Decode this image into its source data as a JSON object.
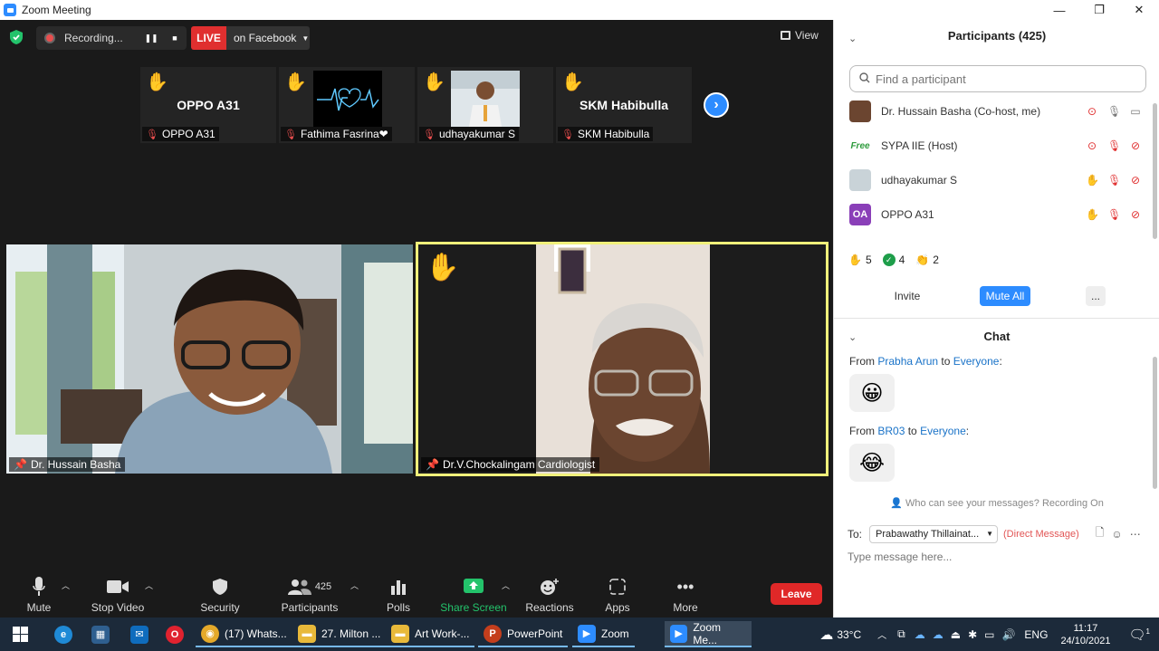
{
  "window": {
    "title": "Zoom Meeting",
    "minimize": "—",
    "maximize": "❐",
    "close": "✕"
  },
  "topbar": {
    "recording_label": "Recording...",
    "live_label": "LIVE",
    "live_destination": "on Facebook",
    "view_label": "View"
  },
  "thumbnails": [
    {
      "big_name": "OPPO A31",
      "label": "OPPO A31"
    },
    {
      "big_name": "",
      "label": "Fathima Fasrina❤"
    },
    {
      "big_name": "",
      "label": "udhayakumar S"
    },
    {
      "big_name": "SKM Habibulla",
      "label": "SKM Habibulla"
    }
  ],
  "main_tiles": [
    {
      "name": "Dr. Hussain Basha"
    },
    {
      "name": "Dr.V.Chockalingam Cardiologist"
    }
  ],
  "toolbar": {
    "mute": "Mute",
    "stop_video": "Stop Video",
    "security": "Security",
    "participants": "Participants",
    "participant_count": "425",
    "polls": "Polls",
    "share_screen": "Share Screen",
    "reactions": "Reactions",
    "apps": "Apps",
    "more": "More",
    "leave": "Leave"
  },
  "participants_panel": {
    "title": "Participants (425)",
    "search_placeholder": "Find a participant",
    "participants": [
      {
        "name": "Dr. Hussain Basha (Co-host, me)",
        "avatar": ""
      },
      {
        "name": "SYPA IIE (Host)",
        "avatar": "Free"
      },
      {
        "name": "udhayakumar S",
        "avatar": ""
      },
      {
        "name": "OPPO A31",
        "avatar": "OA"
      }
    ],
    "reaction_counts": {
      "raised_hands": "5",
      "yes": "4",
      "clap": "2"
    },
    "invite": "Invite",
    "mute_all": "Mute All",
    "more": "..."
  },
  "chat": {
    "title": "Chat",
    "messages": [
      {
        "from_prefix": "From ",
        "sender": "Prabha Arun",
        "to_word": " to ",
        "recipient": "Everyone",
        "emoji": "😀"
      },
      {
        "from_prefix": "From ",
        "sender": "BR03",
        "to_word": " to ",
        "recipient": "Everyone",
        "emoji": "😂"
      }
    ],
    "colon": ":",
    "visibility_note": "Who can see your messages? Recording On",
    "to_label": "To:",
    "to_value": "Prabawathy Thillainat...",
    "dm_note": "(Direct Message)",
    "input_placeholder": "Type message here..."
  },
  "taskbar": {
    "items": [
      {
        "label": "(17) Whats..."
      },
      {
        "label": "27. Milton ..."
      },
      {
        "label": "Art Work-..."
      },
      {
        "label": "PowerPoint"
      },
      {
        "label": "Zoom"
      },
      {
        "label": "Zoom Me..."
      }
    ],
    "temperature": "33°C",
    "language": "ENG",
    "time": "11:17",
    "date": "24/10/2021",
    "notification_count": "1"
  },
  "colors": {
    "accent": "#2d8cff",
    "live_red": "#e02f2f",
    "active_border": "#f0f07a",
    "taskbar": "#1c2a3a"
  }
}
